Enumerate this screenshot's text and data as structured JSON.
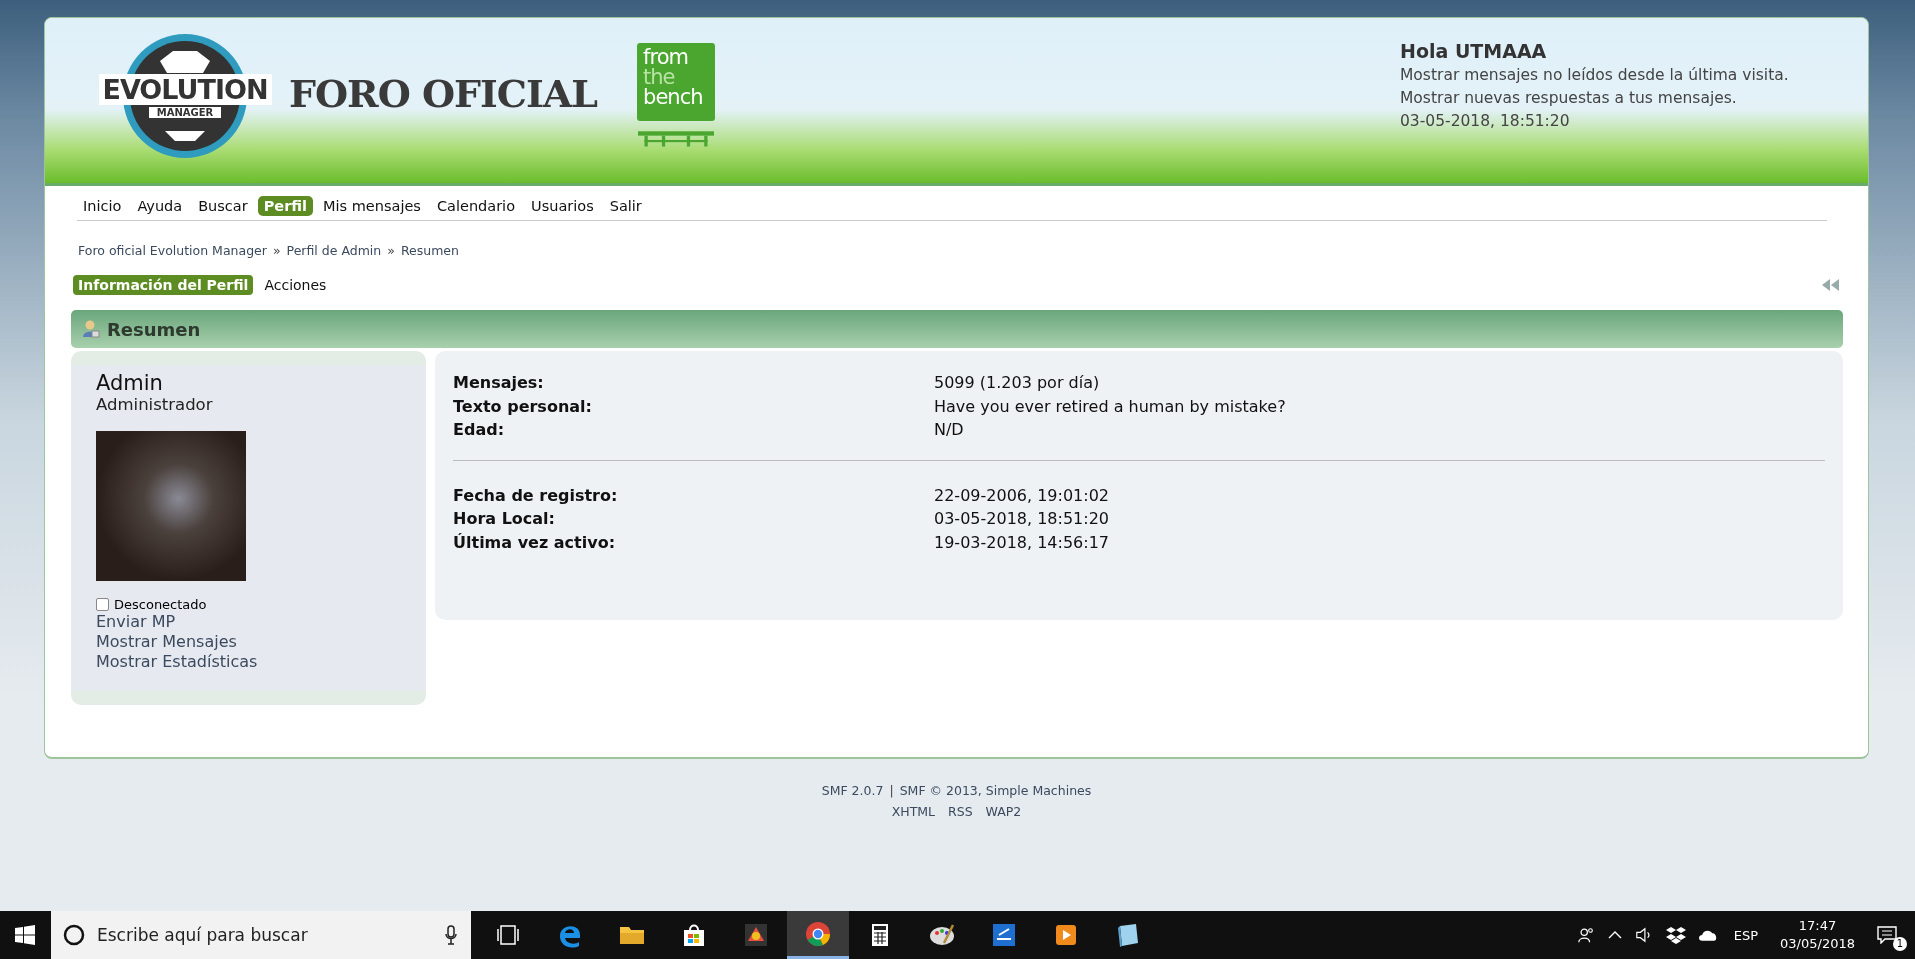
{
  "header": {
    "logo": {
      "word": "EVOLUTION",
      "sub": "MANAGER"
    },
    "title": "FORO OFICIAL",
    "partner": [
      "from",
      "the",
      "bench"
    ],
    "user": {
      "greeting": "Hola UTMAAA",
      "links": [
        "Mostrar mensajes no leídos desde la última visita.",
        "Mostrar nuevas respuestas a tus mensajes."
      ],
      "time": "03-05-2018, 18:51:20"
    }
  },
  "menu": [
    {
      "label": "Inicio",
      "selected": false
    },
    {
      "label": "Ayuda",
      "selected": false
    },
    {
      "label": "Buscar",
      "selected": false
    },
    {
      "label": "Perfil",
      "selected": true
    },
    {
      "label": "Mis mensajes",
      "selected": false
    },
    {
      "label": "Calendario",
      "selected": false
    },
    {
      "label": "Usuarios",
      "selected": false
    },
    {
      "label": "Salir",
      "selected": false
    }
  ],
  "breadcrumbs": [
    "Foro oficial Evolution Manager",
    "Perfil de Admin",
    "Resumen"
  ],
  "breadcrumb_separator": "»",
  "profile_tabs": [
    {
      "label": "Información del Perfil",
      "selected": true
    },
    {
      "label": "Acciones",
      "selected": false
    }
  ],
  "section_title": "Resumen",
  "profile": {
    "name": "Admin",
    "rank": "Administrador",
    "online": false,
    "status": "Desconectado",
    "links": [
      "Enviar MP",
      "Mostrar Mensajes",
      "Mostrar Estadísticas"
    ]
  },
  "details": [
    [
      {
        "label": "Mensajes:",
        "value": "5099 (1.203 por día)"
      },
      {
        "label": "Texto personal:",
        "value": "Have you ever retired a human by mistake?"
      },
      {
        "label": "Edad:",
        "value": "N/D"
      }
    ],
    [
      {
        "label": "Fecha de registro:",
        "value": "22-09-2006, 19:01:02"
      },
      {
        "label": "Hora Local:",
        "value": "03-05-2018, 18:51:20"
      },
      {
        "label": "Última vez activo:",
        "value": "19-03-2018, 14:56:17"
      }
    ]
  ],
  "footer": {
    "credits": [
      "SMF 2.0.7",
      "SMF © 2013, Simple Machines"
    ],
    "credit_separator": "|",
    "links": [
      "XHTML",
      "RSS",
      "WAP2"
    ]
  },
  "taskbar": {
    "search_placeholder": "Escribe aquí para buscar",
    "apps": [
      {
        "kind": "taskview",
        "selected": false
      },
      {
        "kind": "edge",
        "selected": false
      },
      {
        "kind": "folder",
        "selected": false
      },
      {
        "kind": "store",
        "selected": false
      },
      {
        "kind": "colors",
        "selected": false
      },
      {
        "kind": "chrome",
        "selected": true
      },
      {
        "kind": "calculator",
        "selected": false
      },
      {
        "kind": "paint",
        "selected": false
      },
      {
        "kind": "scanner",
        "selected": false
      },
      {
        "kind": "player",
        "selected": false
      },
      {
        "kind": "notebook",
        "selected": false
      }
    ],
    "language": "ESP",
    "time": "17:47",
    "date": "03/05/2018",
    "notifications": "1"
  }
}
